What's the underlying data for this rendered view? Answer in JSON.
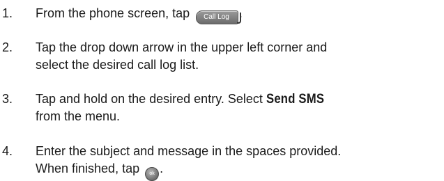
{
  "steps": [
    {
      "number": "1.",
      "before": "From the phone screen, tap",
      "button_label": "Call Log",
      "after": "."
    },
    {
      "number": "2.",
      "line1": "Tap the drop down arrow in the upper left corner and",
      "line2": "select the desired call log list."
    },
    {
      "number": "3.",
      "before": "Tap and hold on the desired entry. Select",
      "command": "Send SMS",
      "line2": "from the menu."
    },
    {
      "number": "4.",
      "line1": "Enter the subject and message in the spaces provided.",
      "before2": "When finished, tap",
      "ok_label": "ok",
      "after2": "."
    }
  ]
}
